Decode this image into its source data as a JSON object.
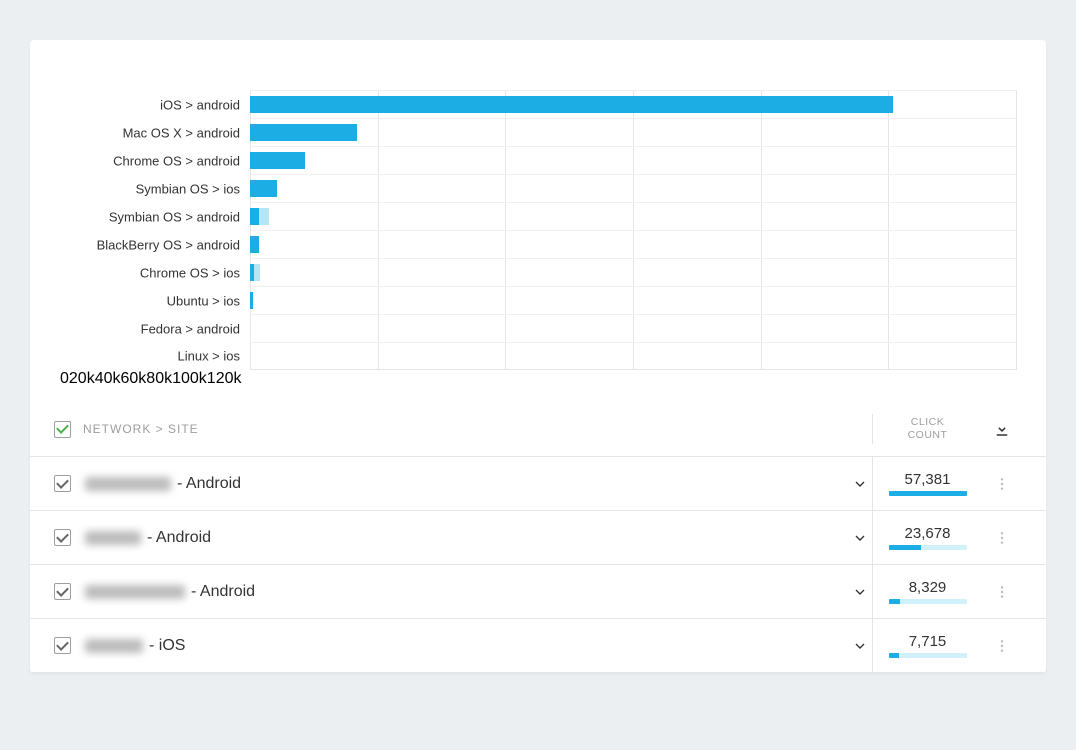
{
  "chart_data": {
    "type": "bar",
    "orientation": "horizontal",
    "xlabel": "",
    "ylabel": "",
    "x_ticks": [
      "0",
      "20k",
      "40k",
      "60k",
      "80k",
      "100k",
      "120k"
    ],
    "x_range": [
      0,
      120000
    ],
    "categories": [
      "iOS > android",
      "Mac OS X > android",
      "Chrome OS > android",
      "Symbian OS > ios",
      "Symbian OS > android",
      "BlackBerry OS > android",
      "Chrome OS > ios",
      "Ubuntu > ios",
      "Fedora > android",
      "Linux > ios"
    ],
    "series": [
      {
        "name": "primary",
        "color": "#1cade4",
        "values": [
          100800,
          16800,
          8600,
          4300,
          1400,
          1400,
          700,
          400,
          0,
          0,
          0
        ]
      },
      {
        "name": "secondary",
        "color": "#b6e5f3",
        "values": [
          0,
          0,
          0,
          0,
          1600,
          0,
          900,
          0,
          0,
          0,
          0
        ]
      }
    ]
  },
  "table": {
    "header_label": "NETWORK > SITE",
    "click_label_line1": "CLICK",
    "click_label_line2": "COUNT",
    "max_click": 57381,
    "rows": [
      {
        "checked": true,
        "blur_w": 86,
        "suffix": " - Android",
        "clicks": 57381,
        "clicks_display": "57,381"
      },
      {
        "checked": true,
        "blur_w": 56,
        "suffix": " - Android",
        "clicks": 23678,
        "clicks_display": "23,678"
      },
      {
        "checked": true,
        "blur_w": 100,
        "suffix": " - Android",
        "clicks": 8329,
        "clicks_display": "8,329"
      },
      {
        "checked": true,
        "blur_w": 58,
        "suffix": " - iOS",
        "clicks": 7715,
        "clicks_display": "7,715"
      }
    ]
  }
}
